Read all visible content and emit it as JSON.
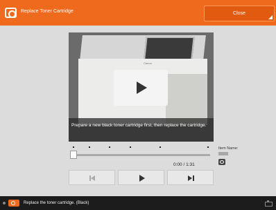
{
  "header": {
    "title": "Replace Toner Cartridge",
    "close_label": "Close",
    "accent_color": "#f06a1e"
  },
  "video": {
    "brand": "Canon",
    "caption": "Prepare a new black toner cartridge first, then replace the cartridge.",
    "current_time": "0:00 / 1:31",
    "progress": 0
  },
  "item_info": {
    "label": "Item Name:"
  },
  "status_bar": {
    "message": "Replace the toner cartridge. (Black)"
  }
}
